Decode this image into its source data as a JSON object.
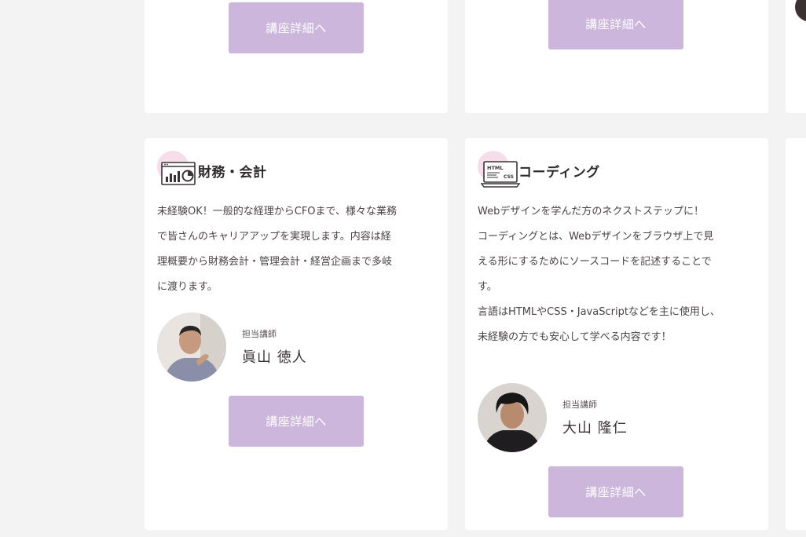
{
  "cards": [
    {
      "button_label": "講座詳細へ"
    },
    {
      "button_label": "講座詳細へ"
    },
    {
      "title": "財務・会計",
      "icon": "chart-monitor-icon",
      "description_lines": [
        "未経験OK！一般的な経理からCFOまで、様々な業務",
        "で皆さんのキャリアアップを実現します。内容は経",
        "理概要から財務会計・管理会計・経営企画まで多岐",
        "に渡ります。"
      ],
      "instructor_role": "担当講師",
      "instructor_name": "眞山 徳人",
      "button_label": "講座詳細へ"
    },
    {
      "title": "コーディング",
      "icon": "html-css-laptop-icon",
      "description_lines": [
        "Webデザインを学んだ方のネクストステップに！",
        "コーディングとは、Webデザインをブラウザ上で見",
        "える形にするためにソースコードを記述することで",
        "す。",
        "言語はHTMLやCSS・JavaScriptなどを主に使用し、",
        "未経験の方でも安心して学べる内容です！"
      ],
      "icon_labels": [
        "HTML",
        "CSS"
      ],
      "instructor_role": "担当講師",
      "instructor_name": "大山 隆仁",
      "button_label": "講座詳細へ"
    }
  ],
  "colors": {
    "page_bg": "#f4f3f4",
    "card_bg": "#ffffff",
    "button_bg": "#cdb6dc",
    "icon_blob": "#f6dde9"
  }
}
